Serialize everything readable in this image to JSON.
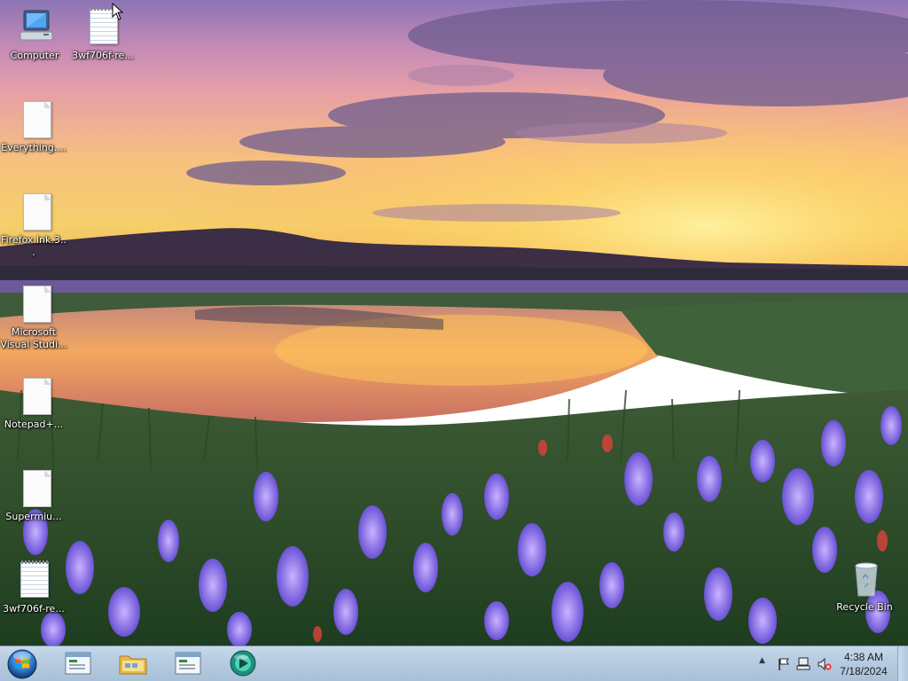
{
  "desktop": {
    "icons": [
      {
        "id": "computer",
        "label": "Computer"
      },
      {
        "id": "3wf706f-top",
        "label": "3wf706f-re..."
      },
      {
        "id": "everything",
        "label": "Everything...."
      },
      {
        "id": "firefox-lnk",
        "label": "Firefox.lnk.3..."
      },
      {
        "id": "msvs",
        "label": "Microsoft Visual Studi..."
      },
      {
        "id": "notepadpp",
        "label": "Notepad+..."
      },
      {
        "id": "supermium",
        "label": "Supermiu..."
      },
      {
        "id": "3wf706f-bottom",
        "label": "3wf706f-re..."
      },
      {
        "id": "recycle-bin",
        "label": "Recycle Bin"
      }
    ]
  },
  "taskbar": {
    "start_label": "Start",
    "pinned": [
      {
        "id": "task-window-1",
        "icon": "window-icon"
      },
      {
        "id": "task-explorer",
        "icon": "folder-icon"
      },
      {
        "id": "task-window-2",
        "icon": "window-icon"
      },
      {
        "id": "task-media",
        "icon": "media-orb-icon"
      }
    ],
    "tray": {
      "show_hidden": "▲",
      "clock_time": "4:38 AM",
      "clock_date": "7/18/2024"
    }
  },
  "colors": {
    "taskbar_top": "#c6d8ea",
    "taskbar_bottom": "#a9c0d8",
    "start_orb": "#2f7fd0"
  }
}
